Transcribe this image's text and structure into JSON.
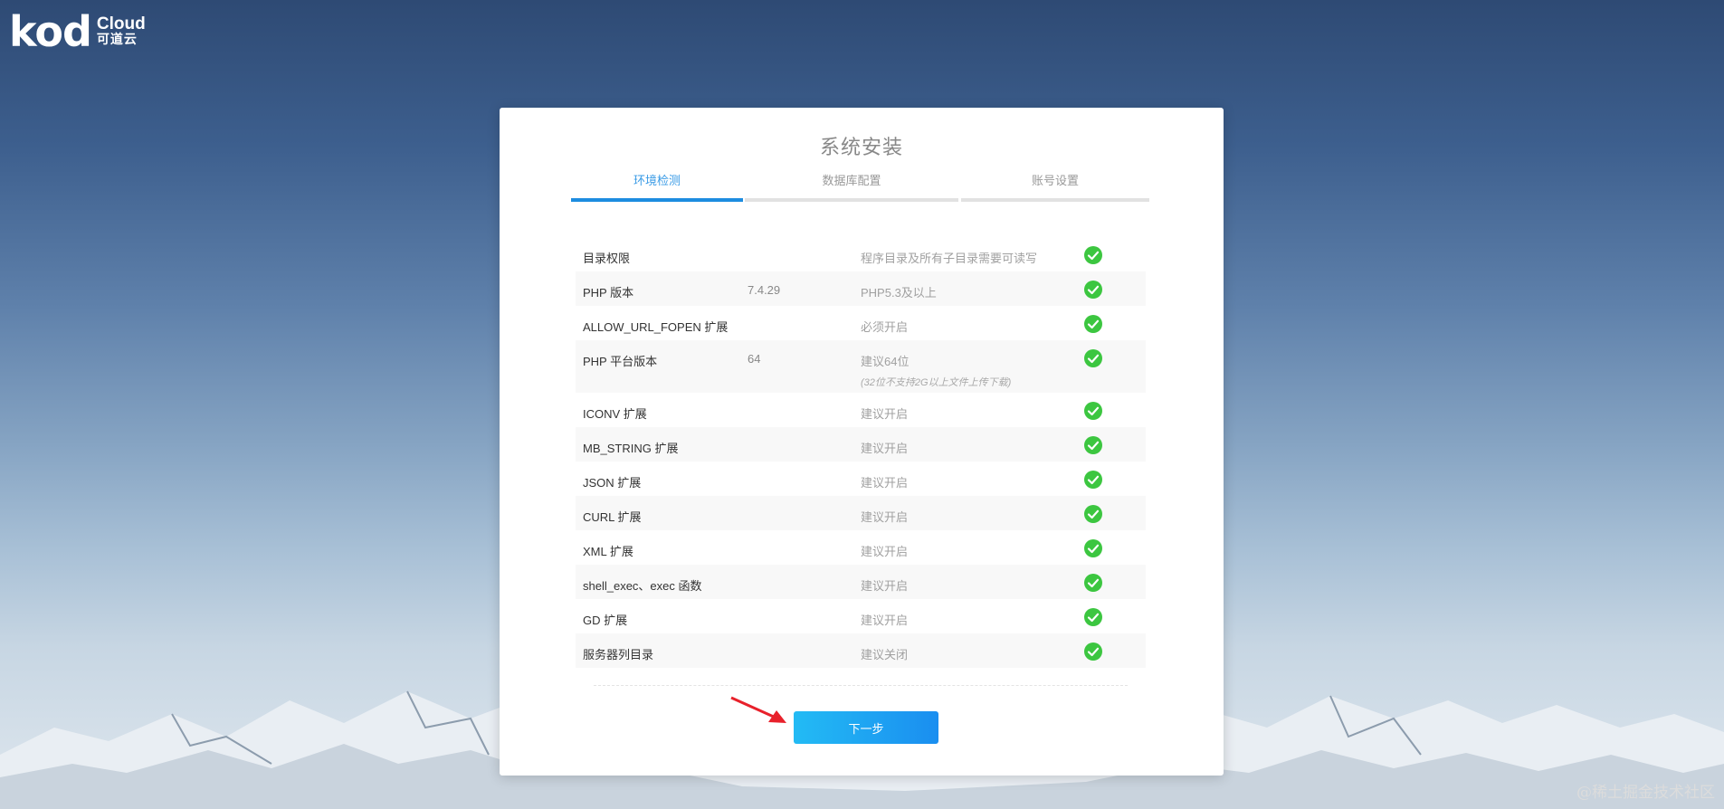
{
  "brand": {
    "logo_text": "kod",
    "logo_sub_en": "Cloud",
    "logo_sub_cn": "可道云"
  },
  "installer": {
    "title": "系统安装",
    "steps": [
      {
        "label": "环境检测",
        "active": true
      },
      {
        "label": "数据库配置",
        "active": false
      },
      {
        "label": "账号设置",
        "active": false
      }
    ],
    "checks": [
      {
        "name": "目录权限",
        "value": "",
        "requirement": "程序目录及所有子目录需要可读写",
        "note": "",
        "status": "pass"
      },
      {
        "name": "PHP 版本",
        "value": "7.4.29",
        "requirement": "PHP5.3及以上",
        "note": "",
        "status": "pass"
      },
      {
        "name": "ALLOW_URL_FOPEN 扩展",
        "value": "",
        "requirement": "必须开启",
        "note": "",
        "status": "pass"
      },
      {
        "name": "PHP 平台版本",
        "value": "64",
        "requirement": "建议64位",
        "note": "(32位不支持2G以上文件上传下载)",
        "status": "pass"
      },
      {
        "name": "ICONV 扩展",
        "value": "",
        "requirement": "建议开启",
        "note": "",
        "status": "pass"
      },
      {
        "name": "MB_STRING 扩展",
        "value": "",
        "requirement": "建议开启",
        "note": "",
        "status": "pass"
      },
      {
        "name": "JSON 扩展",
        "value": "",
        "requirement": "建议开启",
        "note": "",
        "status": "pass"
      },
      {
        "name": "CURL 扩展",
        "value": "",
        "requirement": "建议开启",
        "note": "",
        "status": "pass"
      },
      {
        "name": "XML 扩展",
        "value": "",
        "requirement": "建议开启",
        "note": "",
        "status": "pass"
      },
      {
        "name": "shell_exec、exec 函数",
        "value": "",
        "requirement": "建议开启",
        "note": "",
        "status": "pass"
      },
      {
        "name": "GD 扩展",
        "value": "",
        "requirement": "建议开启",
        "note": "",
        "status": "pass"
      },
      {
        "name": "服务器列目录",
        "value": "",
        "requirement": "建议关闭",
        "note": "",
        "status": "pass"
      }
    ],
    "next_label": "下一步"
  },
  "watermark": "@稀土掘金技术社区",
  "colors": {
    "accent": "#1d8ce0",
    "pass": "#3cc640",
    "button_start": "#23bbf4",
    "button_end": "#1a8ef0",
    "arrow": "#e8212b"
  },
  "icons": {
    "status_pass": "check-circle-icon",
    "pointer": "red-arrow-icon"
  }
}
